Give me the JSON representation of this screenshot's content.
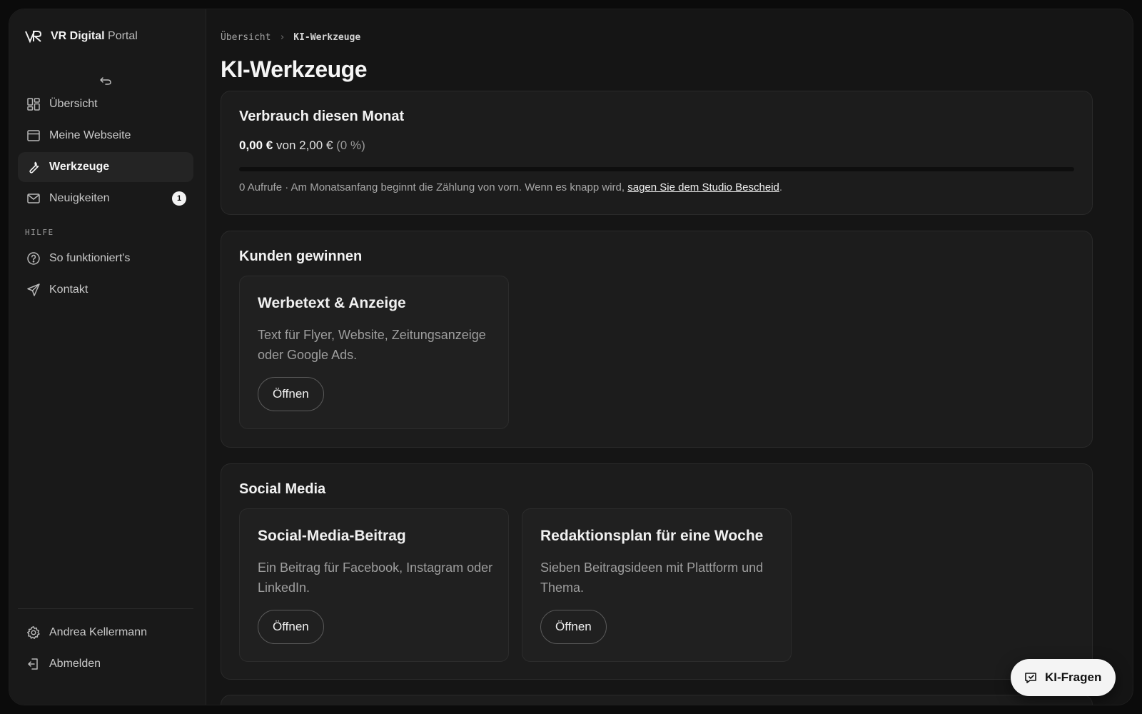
{
  "brand": {
    "name_bold": "VR Digital",
    "name_light": "Portal"
  },
  "sidebar": {
    "nav": [
      {
        "label": "Übersicht",
        "icon": "dashboard-icon"
      },
      {
        "label": "Meine Webseite",
        "icon": "browser-window-icon"
      },
      {
        "label": "Werkzeuge",
        "icon": "wrench-icon",
        "active": true
      },
      {
        "label": "Neuigkeiten",
        "icon": "mail-icon",
        "badge": "1"
      }
    ],
    "section_help": "HILFE",
    "help": [
      {
        "label": "So funktioniert's",
        "icon": "help-circle-icon"
      },
      {
        "label": "Kontakt",
        "icon": "send-icon"
      }
    ],
    "footer": [
      {
        "label": "Andrea Kellermann",
        "icon": "gear-icon"
      },
      {
        "label": "Abmelden",
        "icon": "logout-icon"
      }
    ]
  },
  "breadcrumb": {
    "parent": "Übersicht",
    "separator": "›",
    "current": "KI-Werkzeuge"
  },
  "page_title": "KI-Werkzeuge",
  "usage": {
    "title": "Verbrauch diesen Monat",
    "used": "0,00 €",
    "of_text": "von 2,00 €",
    "percent_text": "(0 %)",
    "fraction": 0.0,
    "note_prefix": "0 Aufrufe · Am Monatsanfang beginnt die Zählung von vorn. Wenn es knapp wird,",
    "note_link": "sagen Sie dem Studio Bescheid",
    "note_suffix": "."
  },
  "sections": [
    {
      "title": "Kunden gewinnen",
      "tools": [
        {
          "title": "Werbetext & Anzeige",
          "desc": "Text für Flyer, Website, Zeitungsanzeige oder Google Ads.",
          "button": "Öffnen"
        }
      ]
    },
    {
      "title": "Social Media",
      "tools": [
        {
          "title": "Social-Media-Beitrag",
          "desc": "Ein Beitrag für Facebook, Instagram oder LinkedIn.",
          "button": "Öffnen"
        },
        {
          "title": "Redaktionsplan für eine Woche",
          "desc": "Sieben Beitragsideen mit Plattform und Thema.",
          "button": "Öffnen"
        }
      ]
    }
  ],
  "fab": {
    "label": "KI-Fragen",
    "icon": "chat-icon"
  }
}
